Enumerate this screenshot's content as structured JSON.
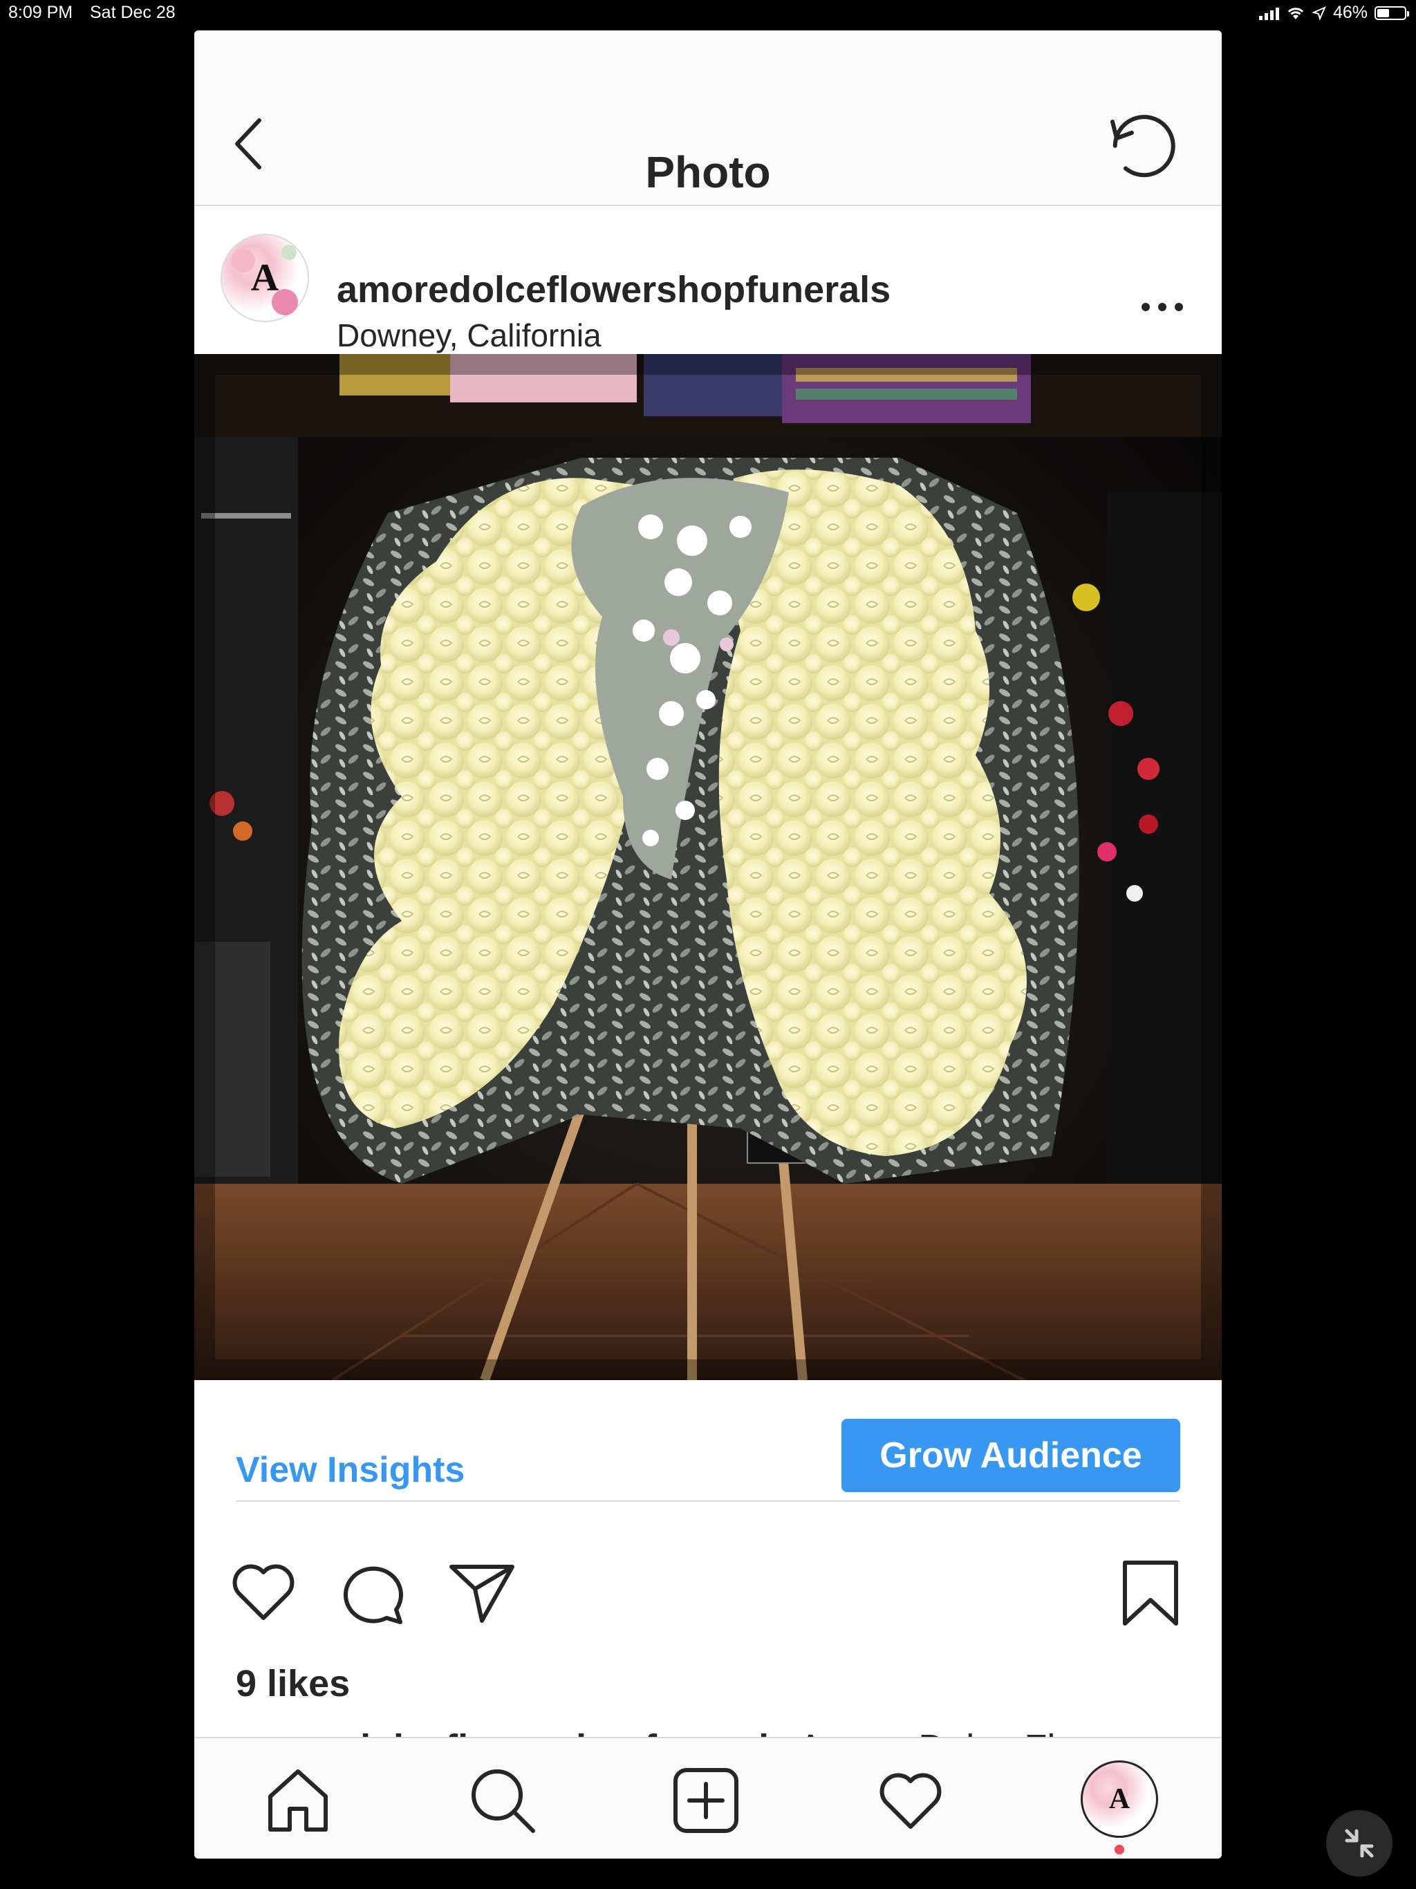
{
  "status_bar": {
    "time": "8:09 PM",
    "date": "Sat Dec 28",
    "battery_text": "46%",
    "battery_level": 0.46
  },
  "nav": {
    "title": "Photo",
    "back_icon": "chevron-left-icon",
    "refresh_icon": "refresh-icon"
  },
  "post": {
    "avatar_letter": "A",
    "username": "amoredolceflowershopfunerals",
    "location": "Downey, California"
  },
  "insights": {
    "view_label": "View Insights",
    "grow_label": "Grow Audience"
  },
  "engagement": {
    "likes": "9 likes",
    "caption_user": "amoredolceflowershopfunerals",
    "caption_text": " Amore Dolce Flower"
  },
  "tab_avatar_letter": "A",
  "colors": {
    "accent": "#3897f0",
    "text": "#262626",
    "divider": "#dbdbdb",
    "notification": "#ed4956"
  }
}
